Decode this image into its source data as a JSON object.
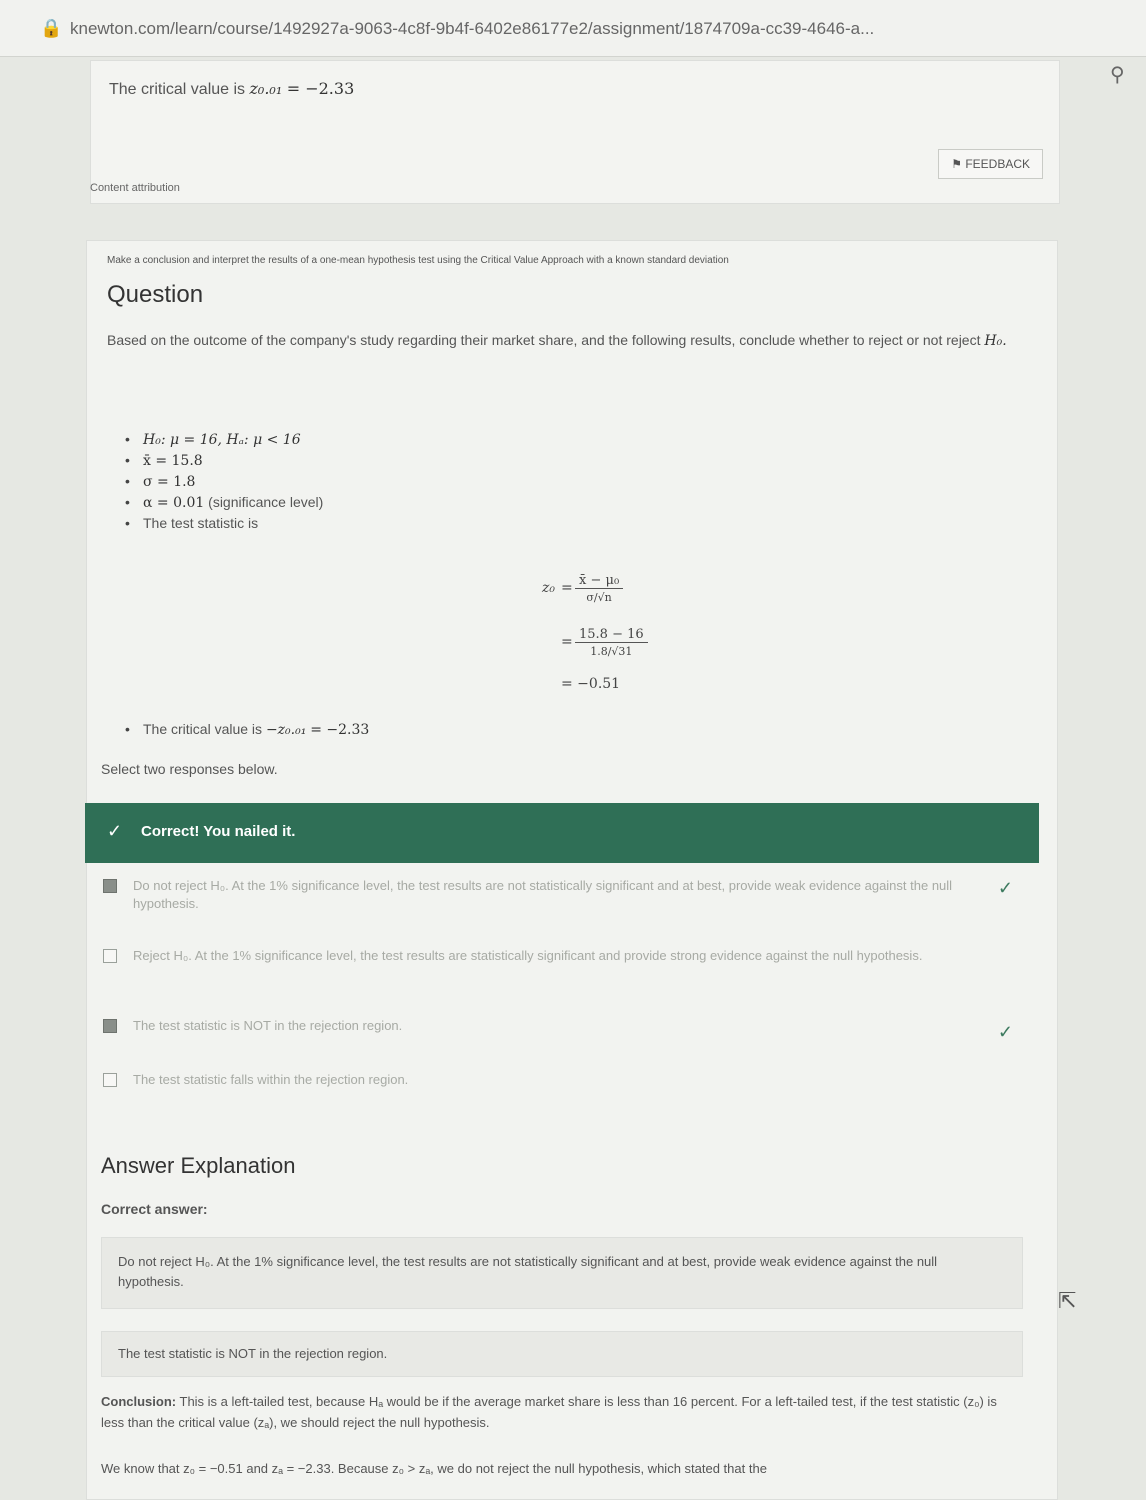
{
  "browser": {
    "url": "knewton.com/learn/course/1492927a-9063-4c8f-9b4f-6402e86177e2/assignment/1874709a-cc39-4646-a..."
  },
  "previous_card": {
    "critical_prefix": "The critical value is",
    "critical_symbol": "z₀.₀₁",
    "critical_equals": "= −2.33",
    "feedback_label": "FEEDBACK"
  },
  "attribution": "Content attribution",
  "question": {
    "topic": "Make a conclusion and interpret the results of a one-mean hypothesis test using the Critical Value Approach with a known standard deviation",
    "title": "Question",
    "text_prefix": "Based on the outcome of the company's study regarding their market share, and the following results, conclude whether to reject or not reject",
    "text_hyp": "H₀.",
    "facts": [
      {
        "math": "H₀: μ = 16, Hₐ: μ < 16",
        "note": ""
      },
      {
        "math": "x̄ = 15.8",
        "note": ""
      },
      {
        "math": "σ = 1.8",
        "note": ""
      },
      {
        "math": "α = 0.01",
        "note": "(significance level)"
      },
      {
        "math": "",
        "note": "The test statistic is"
      }
    ],
    "formula": {
      "lhs": "z₀",
      "num1": "x̄ − μ₀",
      "den1": "σ/√n",
      "num2": "15.8 − 16",
      "den2": "1.8/√31",
      "result": "= −0.51"
    },
    "critical_prefix": "The critical value is",
    "critical_symbol": "−z₀.₀₁",
    "critical_equals": "= −2.33",
    "select_two": "Select two responses below.",
    "banner": "Correct! You nailed it."
  },
  "options": [
    {
      "text": "Do not reject H₀. At the 1% significance level, the test results are not statistically significant and at best, provide weak evidence against the null hypothesis.",
      "checked": true,
      "correct": true
    },
    {
      "text": "Reject H₀. At the 1% significance level, the test results are statistically significant and provide strong evidence against the null hypothesis.",
      "checked": false,
      "correct": false
    },
    {
      "text": "The test statistic is NOT in the rejection region.",
      "checked": true,
      "correct": true
    },
    {
      "text": "The test statistic falls within the rejection region.",
      "checked": false,
      "correct": false
    }
  ],
  "explanation": {
    "title": "Answer Explanation",
    "correct_label": "Correct answer:",
    "answer1": "Do not reject H₀. At the 1% significance level, the test results are not statistically significant and at best, provide weak evidence against the null hypothesis.",
    "answer2": "The test statistic is NOT in the rejection region.",
    "conclusion_label": "Conclusion:",
    "conclusion_text": "This is a left-tailed test, because Hₐ would be if the average market share is less than 16 percent. For a left-tailed test, if the test statistic (z₀) is less than the critical value (zₐ), we should reject the null hypothesis.",
    "know_that": "We know that z₀ = −0.51 and zₐ = −2.33. Because z₀ > zₐ, we do not reject the null hypothesis, which stated that the"
  }
}
